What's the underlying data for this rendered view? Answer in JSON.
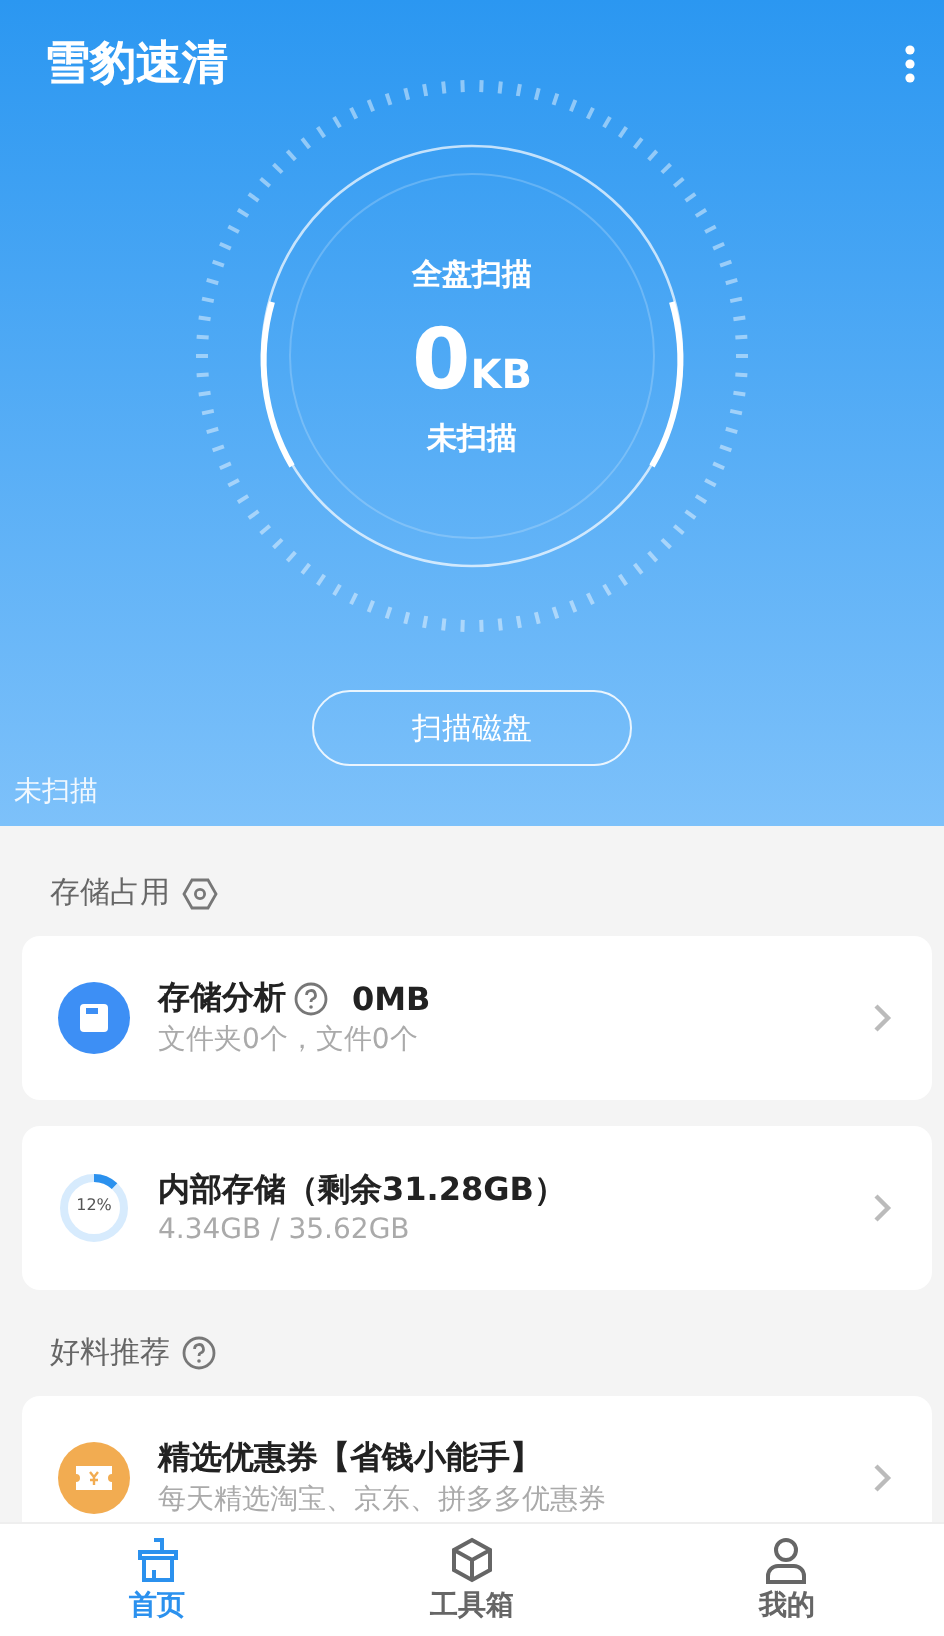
{
  "app_title": "雪豹速清",
  "scan": {
    "label": "全盘扫描",
    "amount": "0",
    "unit": "KB",
    "status": "未扫描",
    "button": "扫描磁盘",
    "footer_status": "未扫描"
  },
  "sections": [
    {
      "title": "存储占用",
      "cards": [
        {
          "kind": "disk",
          "title": "存储分析",
          "value": "0MB",
          "subtitle": "文件夹0个，文件0个"
        },
        {
          "kind": "ring",
          "title": "内部存储（剩余31.28GB）",
          "percent": "12%",
          "level": 0.12,
          "subtitle": "4.34GB / 35.62GB"
        }
      ]
    },
    {
      "title": "好料推荐",
      "cards": [
        {
          "kind": "coupon",
          "title": "精选优惠券【省钱小能手】",
          "subtitle": "每天精选淘宝、京东、拼多多优惠券"
        }
      ]
    }
  ],
  "nav": [
    {
      "label": "首页",
      "selected": true
    },
    {
      "label": "工具箱",
      "selected": false
    },
    {
      "label": "我的",
      "selected": false
    }
  ]
}
